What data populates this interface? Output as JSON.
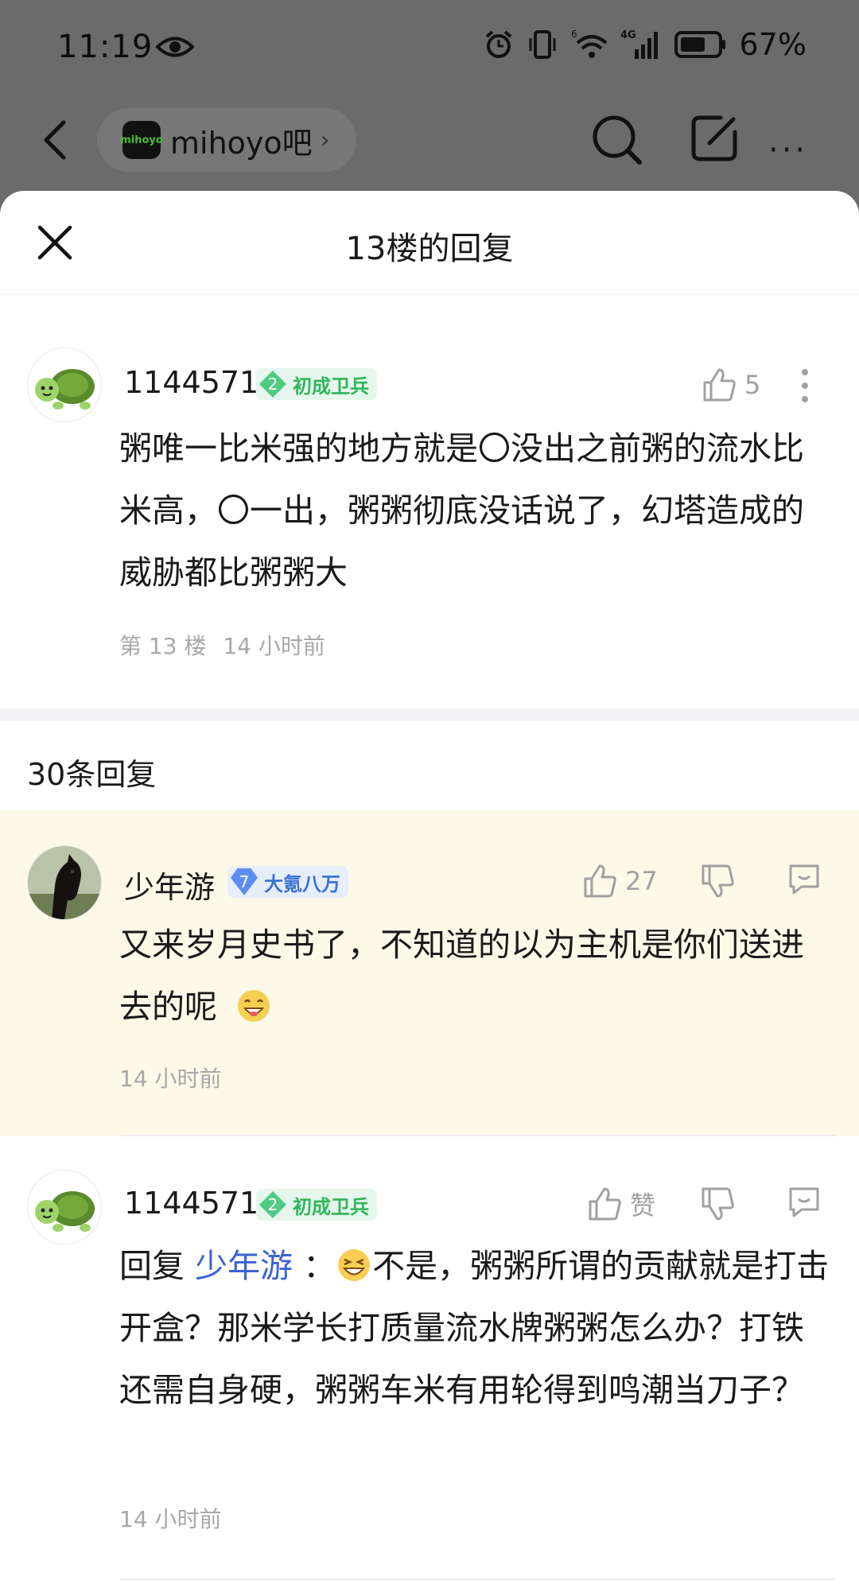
{
  "status_bar": {
    "time": "11:19",
    "network": "4G",
    "signal_prefix": "6",
    "battery": "67%"
  },
  "nav": {
    "forum_logo": "mihoyo",
    "forum_name": "mihoyo吧",
    "chevron": "›",
    "more": "···"
  },
  "sheet": {
    "title": "13楼的回复",
    "reply_count": "30条回复"
  },
  "main_comment": {
    "username": "1144571",
    "badge_level": "2",
    "badge_title": "初成卫兵",
    "likes": "5",
    "text": "粥唯一比米强的地方就是〇没出之前粥的流水比米高，〇一出，粥粥彻底没话说了，幻塔造成的威胁都比粥粥大",
    "floor": "第 13 楼",
    "time": "14 小时前"
  },
  "replies": [
    {
      "username": "少年游",
      "badge_level": "7",
      "badge_title": "大氪八万",
      "likes": "27",
      "text": "又来岁月史书了，不知道的以为主机是你们送进去的呢",
      "emoji": "grin-emoji",
      "time": "14 小时前"
    },
    {
      "username": "1144571",
      "badge_level": "2",
      "badge_title": "初成卫兵",
      "likes": "赞",
      "reply_prefix": "回复 ",
      "mention": "少年游",
      "colon": " ：",
      "emoji": "laugh-emoji",
      "text": "不是，粥粥所谓的贡献就是打击开盒？那米学长打质量流水牌粥粥怎么办？打铁还需自身硬，粥粥车米有用轮得到鸣潮当刀子？",
      "time": "14 小时前"
    }
  ],
  "icons": [
    "eye-icon",
    "alarm-icon",
    "vibrate-icon",
    "wifi-icon",
    "signal-icon",
    "battery-icon",
    "back-icon",
    "search-icon",
    "edit-icon",
    "more-icon",
    "close-icon",
    "thumbs-up-icon",
    "thumbs-down-icon",
    "comment-icon",
    "more-vertical-icon"
  ],
  "colors": {
    "dim_overlay": "#6b6b6b",
    "highlight_row": "#fdf9e8",
    "mention": "#3b63d4",
    "badge_green": "#2fb55c",
    "badge_blue": "#3870d6"
  }
}
